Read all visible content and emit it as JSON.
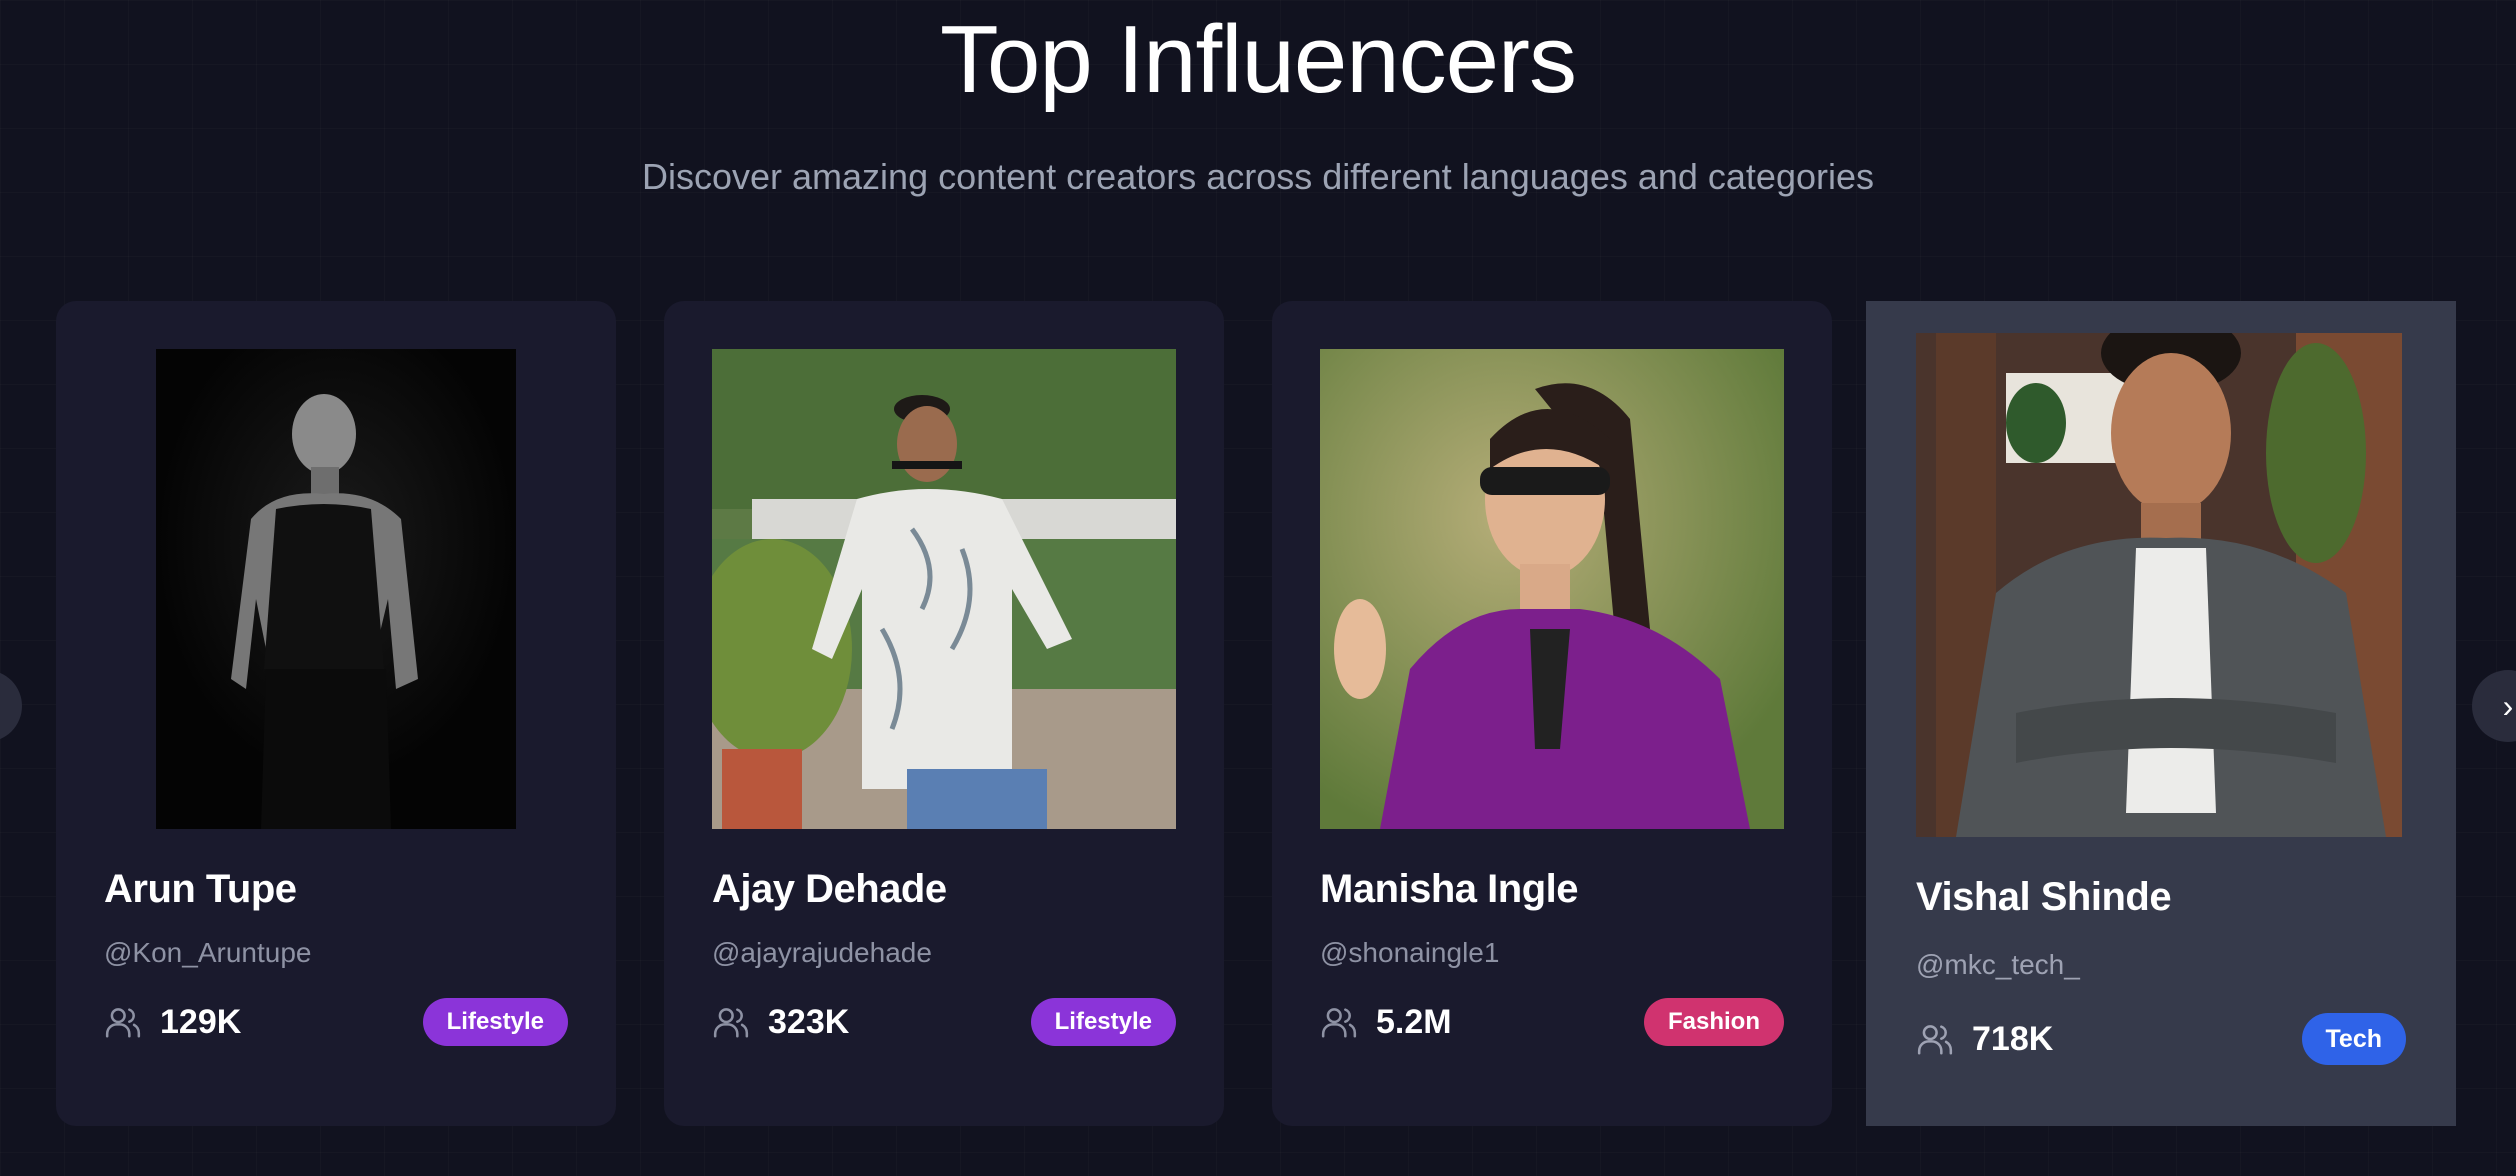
{
  "header": {
    "title": "Top Influencers",
    "subtitle": "Discover amazing content creators across different languages and categories"
  },
  "nav": {
    "prev_icon": "chevron-left-icon",
    "next_icon": "chevron-right-icon",
    "next_glyph": "›"
  },
  "cards": [
    {
      "name": "Arun Tupe",
      "handle": "@Kon_Aruntupe",
      "followers": "129K",
      "category": "Lifestyle",
      "category_color": "#8b34d9"
    },
    {
      "name": "Ajay Dehade",
      "handle": "@ajayrajudehade",
      "followers": "323K",
      "category": "Lifestyle",
      "category_color": "#8b34d9"
    },
    {
      "name": "Manisha Ingle",
      "handle": "@shonaingle1",
      "followers": "5.2M",
      "category": "Fashion",
      "category_color": "#d0336f"
    },
    {
      "name": "Vishal Shinde",
      "handle": "@mkc_tech_",
      "followers": "718K",
      "category": "Tech",
      "category_color": "#2f63e8"
    }
  ],
  "colors": {
    "background": "#11121f",
    "card": "#1a1a2d",
    "card_hover": "#363a4b",
    "text_muted": "#8e92a4"
  }
}
